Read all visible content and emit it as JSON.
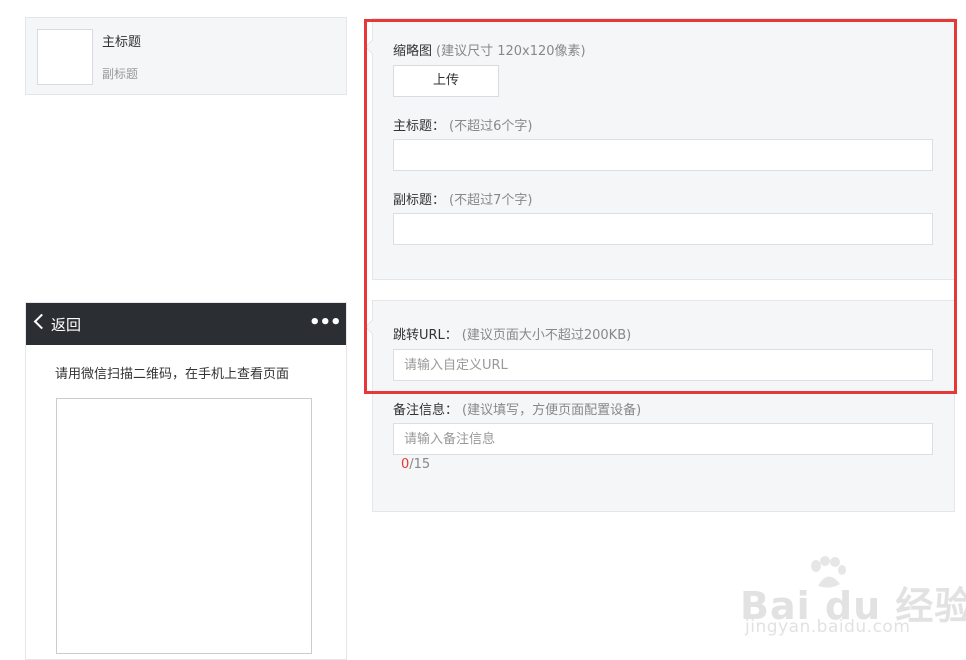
{
  "preview_card": {
    "title": "主标题",
    "subtitle": "副标题"
  },
  "phone": {
    "back_label": "返回",
    "more_icon": "•••",
    "scan_text": "请用微信扫描二维码，在手机上查看页面"
  },
  "editor": {
    "thumbnail": {
      "label": "缩略图",
      "hint": "(建议尺寸 120x120像素)",
      "upload_label": "上传"
    },
    "main_title": {
      "label": "主标题：",
      "hint": "(不超过6个字)",
      "value": ""
    },
    "sub_title": {
      "label": "副标题：",
      "hint": "(不超过7个字)",
      "value": ""
    },
    "jump_url": {
      "label": "跳转URL：",
      "hint": "(建议页面大小不超过200KB)",
      "placeholder": "请输入自定义URL",
      "value": ""
    },
    "remark": {
      "label": "备注信息：",
      "hint": "(建议填写，方便页面配置设备)",
      "placeholder": "请输入备注信息",
      "value": "",
      "count_current": "0",
      "count_max": "/15"
    }
  },
  "colors": {
    "highlight": "#e53939",
    "counter_current": "#e53935",
    "nav_bg": "#2b2f33"
  },
  "watermark": {
    "logo_text": "Bai du 经验",
    "url_text": "jingyan.baidu.com"
  }
}
